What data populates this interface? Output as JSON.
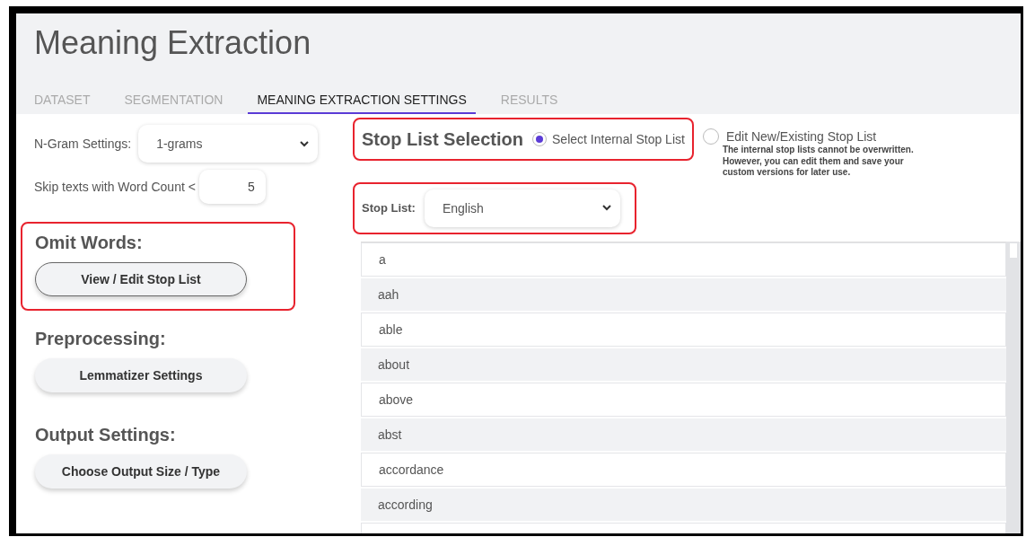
{
  "title": "Meaning Extraction",
  "tabs": [
    {
      "label": "DATASET",
      "selected": false
    },
    {
      "label": "SEGMENTATION",
      "selected": false
    },
    {
      "label": "MEANING EXTRACTION SETTINGS",
      "selected": true
    },
    {
      "label": "RESULTS",
      "selected": false
    }
  ],
  "ngram": {
    "label": "N-Gram Settings:",
    "value": "1-grams"
  },
  "skip": {
    "label": "Skip texts with Word Count <",
    "value": "5"
  },
  "sections": [
    {
      "heading": "Omit Words:",
      "button": "View / Edit Stop List",
      "highlighted": true
    },
    {
      "heading": "Preprocessing:",
      "button": "Lemmatizer Settings",
      "highlighted": false
    },
    {
      "heading": "Output Settings:",
      "button": "Choose Output Size / Type",
      "highlighted": false
    }
  ],
  "stop_list_selection": {
    "heading": "Stop List Selection",
    "options": [
      {
        "label": "Select Internal Stop List",
        "selected": true
      },
      {
        "label": "Edit New/Existing Stop List",
        "selected": false
      }
    ],
    "note": "The internal stop lists cannot be overwritten. However, you can edit them and save your custom versions for later use."
  },
  "stop_list": {
    "label": "Stop List:",
    "value": "English"
  },
  "words": [
    {
      "text": "a"
    },
    {
      "text": "aah"
    },
    {
      "text": "able"
    },
    {
      "text": "about"
    },
    {
      "text": "above"
    },
    {
      "text": "abst"
    },
    {
      "text": "accordance"
    },
    {
      "text": "according"
    }
  ]
}
